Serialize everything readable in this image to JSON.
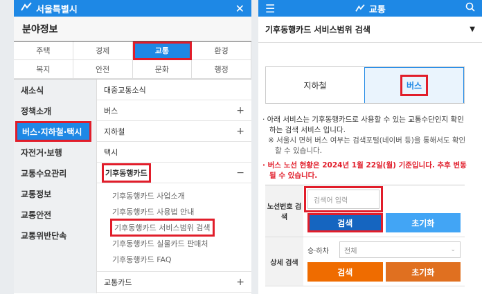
{
  "left": {
    "header_logo": "서울특별시",
    "section_title": "분야정보",
    "tabs": [
      "주택",
      "경제",
      "교통",
      "환경",
      "복지",
      "안전",
      "문화",
      "행정"
    ],
    "categories": [
      "새소식",
      "정책소개",
      "버스·지하철·택시",
      "자전거·보행",
      "교통수요관리",
      "교통정보",
      "교통안전",
      "교통위반단속"
    ],
    "sub_items": {
      "item0": "대중교통소식",
      "item1": "버스",
      "item2": "지하철",
      "item3": "택시",
      "item4": "기후동행카드",
      "item5": "교통카드"
    },
    "leaves": [
      "기후동행카드 사업소개",
      "기후동행카드 사용법 안내",
      "기후동행카드 서비스범위 검색",
      "기후동행카드 실물카드 판매처",
      "기후동행카드 FAQ"
    ]
  },
  "right": {
    "header_title": "교통",
    "select_title": "기후동행카드 서비스범위 검색",
    "tab_subway": "지하철",
    "tab_bus": "버스",
    "note1": "· 아래 서비스는 기후동행카드로 사용할 수 있는 교통수단인지 확인하는 검색 서비스 입니다.",
    "note2": "※ 서울시 면허 버스 여부는 검색포털(네이버 등)을 통해서도 확인할 수 있습니다.",
    "note3": "· 버스 노선 현황은 2024년 1월 22일(월) 기준입니다. 추후 변동될 수 있습니다.",
    "route_label": "노선번호 검색",
    "input_placeholder": "검색어 입력",
    "search_btn": "검색",
    "reset_btn": "초기화",
    "detail_label": "상세 검색",
    "boarding_label": "승·하차",
    "boarding_value": "전체",
    "search_btn2": "검색",
    "reset_btn2": "초기화"
  }
}
